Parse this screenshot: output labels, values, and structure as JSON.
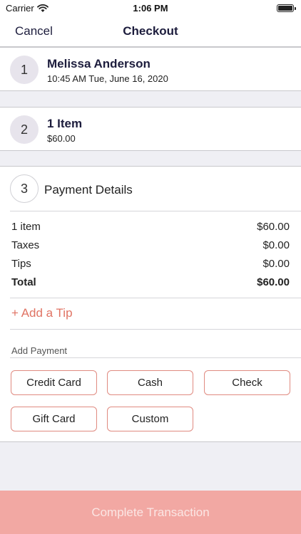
{
  "status_bar": {
    "carrier": "Carrier",
    "time": "1:06 PM",
    "icons": [
      "wifi-icon",
      "battery-icon"
    ]
  },
  "nav": {
    "cancel_label": "Cancel",
    "title": "Checkout"
  },
  "steps": [
    {
      "number": "1",
      "primary": "Melissa Anderson",
      "secondary": "10:45 AM Tue, June 16, 2020"
    },
    {
      "number": "2",
      "primary": "1 Item",
      "secondary": "$60.00"
    },
    {
      "number": "3",
      "title": "Payment Details"
    }
  ],
  "payment_details": {
    "lines": [
      {
        "label": "1 item",
        "value": "$60.00"
      },
      {
        "label": "Taxes",
        "value": "$0.00"
      },
      {
        "label": "Tips",
        "value": "$0.00"
      },
      {
        "label": "Total",
        "value": "$60.00"
      }
    ],
    "add_tip_label": "+ Add a Tip",
    "add_payment_label": "Add Payment",
    "payment_methods": [
      "Credit Card",
      "Cash",
      "Check",
      "Gift Card",
      "Custom"
    ]
  },
  "complete_label": "Complete Transaction",
  "colors": {
    "accent": "#e07363",
    "button_border": "#e08a80",
    "complete_bg": "#f2a8a3",
    "step_fill": "#e7e4ec",
    "title": "#1d1d3d"
  }
}
